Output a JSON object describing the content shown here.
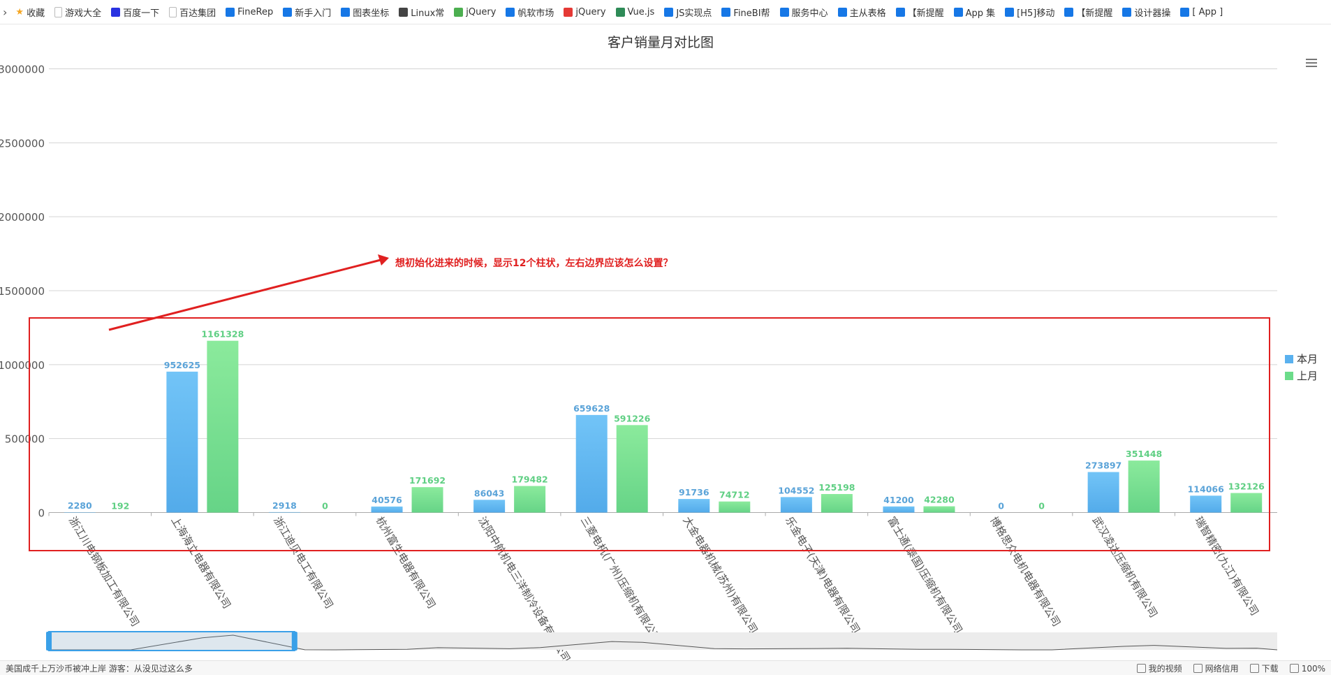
{
  "bookmarks": [
    {
      "label": "收藏",
      "icon": "star-icon",
      "color": "#f5a623"
    },
    {
      "label": "游戏大全",
      "icon": "page-icon",
      "color": "#bbbbbb"
    },
    {
      "label": "百度一下",
      "icon": "baidu-icon",
      "color": "#2932e1"
    },
    {
      "label": "百达集团",
      "icon": "page-icon",
      "color": "#bbbbbb"
    },
    {
      "label": "FineRep",
      "icon": "finereport-icon",
      "color": "#1677e6"
    },
    {
      "label": "新手入门",
      "icon": "finereport-icon",
      "color": "#1677e6"
    },
    {
      "label": "图表坐标",
      "icon": "finereport-icon",
      "color": "#1677e6"
    },
    {
      "label": "Linux常",
      "icon": "linux-icon",
      "color": "#444444"
    },
    {
      "label": "jQuery",
      "icon": "jquery-icon",
      "color": "#4caf50"
    },
    {
      "label": "帆软市场",
      "icon": "finereport-icon",
      "color": "#1677e6"
    },
    {
      "label": "jQuery",
      "icon": "jquery-red-icon",
      "color": "#e53935"
    },
    {
      "label": "Vue.js",
      "icon": "vue-icon",
      "color": "#2e8b57"
    },
    {
      "label": "JS实现点",
      "icon": "finereport-icon",
      "color": "#1677e6"
    },
    {
      "label": "FineBI帮",
      "icon": "finebi-icon",
      "color": "#1677e6"
    },
    {
      "label": "服务中心",
      "icon": "finereport-icon",
      "color": "#1677e6"
    },
    {
      "label": "主从表格",
      "icon": "finereport-icon",
      "color": "#1677e6"
    },
    {
      "label": "【新提醒",
      "icon": "finereport-icon",
      "color": "#1677e6"
    },
    {
      "label": "App 集",
      "icon": "finereport-icon",
      "color": "#1677e6"
    },
    {
      "label": "[H5]移动",
      "icon": "finereport-icon",
      "color": "#1677e6"
    },
    {
      "label": "【新提醒",
      "icon": "finereport-icon",
      "color": "#1677e6"
    },
    {
      "label": "设计器操",
      "icon": "finereport-icon",
      "color": "#1677e6"
    },
    {
      "label": "[ App ]",
      "icon": "finereport-icon",
      "color": "#1677e6"
    }
  ],
  "chart_data": {
    "type": "bar",
    "title": "客户销量月对比图",
    "categories": [
      "浙江川电钢板加工有限公司",
      "上海海立电器有限公司",
      "浙江迪贝电工有限公司",
      "杭州富生电器有限公司",
      "沈阳中航机电三洋制冷设备有限公司",
      "三菱电机(广州)压缩机有限公司",
      "大金电器机械(苏州)有限公司",
      "乐金电子(天津)电器有限公司",
      "富士通(泰国)压缩机有限公司",
      "博格思众电机电器有限公司",
      "武汉凌达压缩机有限公司",
      "瑞智精密(九江)有限公司"
    ],
    "series": [
      {
        "name": "本月",
        "color": "#5ab1ef",
        "values": [
          2280,
          952625,
          2918,
          40576,
          86043,
          659628,
          91736,
          104552,
          41200,
          0,
          273897,
          114066
        ]
      },
      {
        "name": "上月",
        "color": "#6cdc8a",
        "values": [
          192,
          1161328,
          0,
          171692,
          179482,
          591226,
          74712,
          125198,
          42280,
          0,
          351448,
          132126
        ]
      }
    ],
    "ylim": [
      0,
      3000000
    ],
    "yticks": [
      0,
      500000,
      1000000,
      1500000,
      2000000,
      2500000,
      3000000
    ],
    "grid": true,
    "legend": "right-middle",
    "datazoom": {
      "start_fraction": 0.0,
      "end_fraction": 0.2
    },
    "annotation": {
      "text": "想初始化进来的时候，显示12个柱状，左右边界应该怎么设置？",
      "color": "#e02020"
    }
  },
  "toolbox": {
    "menu_icon": "hamburger-icon"
  },
  "statusbar": {
    "left_text": "美国成千上万沙币被冲上岸 游客：从没见过这么多",
    "right_items": [
      "我的视频",
      "网络信用",
      "下载",
      "100%"
    ]
  }
}
